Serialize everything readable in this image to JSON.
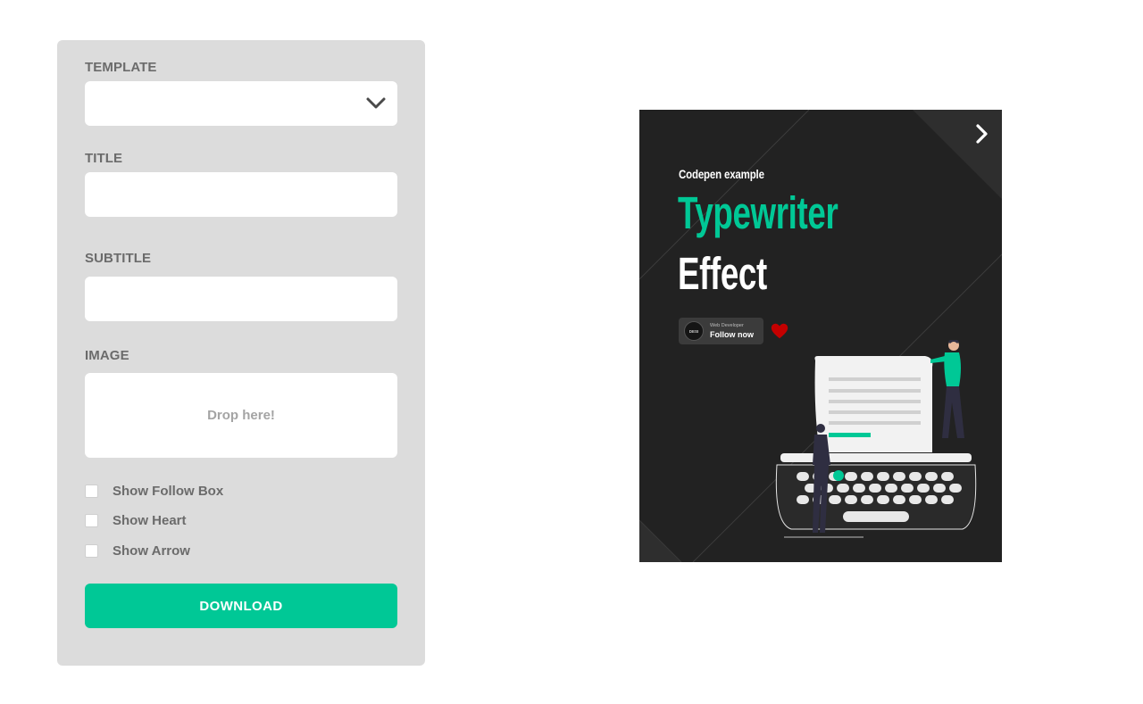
{
  "form": {
    "template_label": "TEMPLATE",
    "template_value": "",
    "title_label": "TITLE",
    "title_value": "",
    "subtitle_label": "SUBTITLE",
    "subtitle_value": "",
    "image_label": "IMAGE",
    "dropzone_text": "Drop here!",
    "options": [
      {
        "label": "Show Follow Box",
        "checked": false
      },
      {
        "label": "Show Heart",
        "checked": false
      },
      {
        "label": "Show Arrow",
        "checked": false
      }
    ],
    "download_label": "DOWNLOAD"
  },
  "preview": {
    "kicker": "Codepen example",
    "title_line1": "Typewriter",
    "title_line2": "Effect",
    "follow_box": {
      "avatar_text": "DESI",
      "role": "Web Developer",
      "cta": "Follow now"
    },
    "icons": {
      "arrow": "chevron-right-icon",
      "heart": "heart-icon"
    }
  },
  "colors": {
    "accent": "#00c896",
    "panel_bg": "#dcdcdc",
    "preview_bg": "#222222",
    "heart": "#c40000",
    "label_text": "#6b6b6b"
  }
}
